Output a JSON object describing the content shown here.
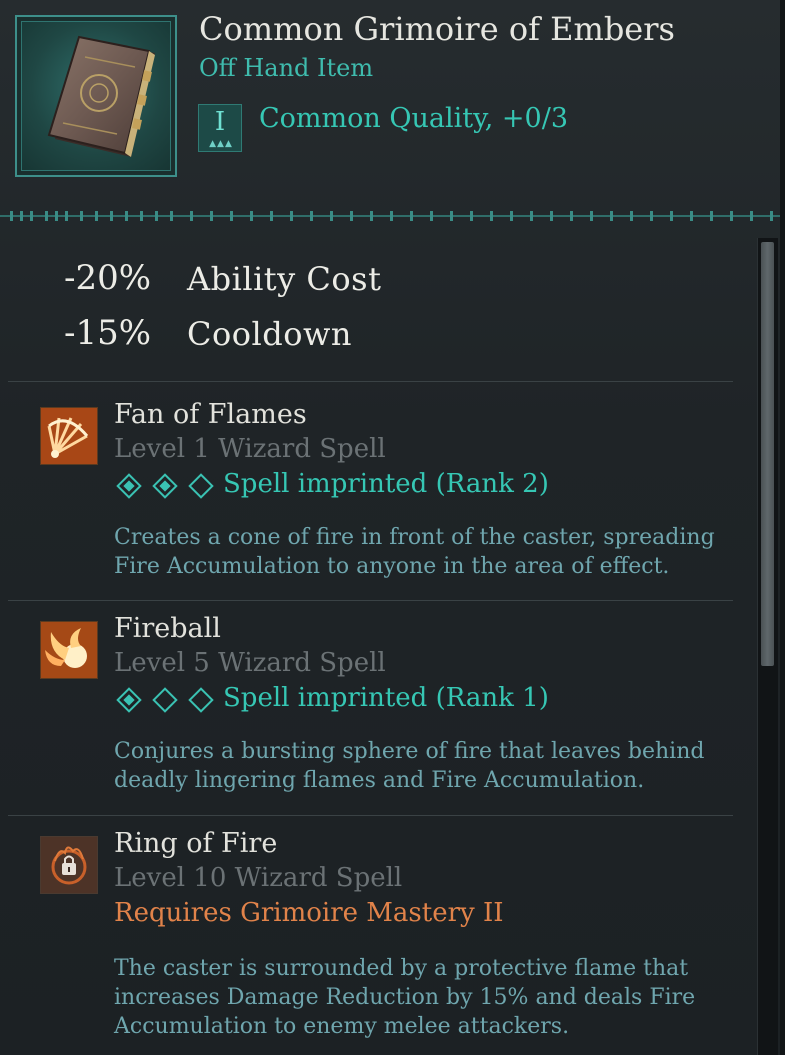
{
  "item": {
    "title": "Common Grimoire of Embers",
    "type": "Off Hand Item",
    "quality_numeral": "I",
    "quality_text": "Common Quality, +0/3",
    "icon": "grimoire-book-icon"
  },
  "stats": [
    {
      "value": "-20%",
      "label": "Ability Cost"
    },
    {
      "value": "-15%",
      "label": "Cooldown"
    }
  ],
  "spells": [
    {
      "name": "Fan of Flames",
      "level": "Level 1 Wizard Spell",
      "rank_filled": 2,
      "rank_total": 3,
      "rank_text": "Spell imprinted (Rank 2)",
      "description_lines": [
        "Creates a cone of fire in front of the caster, spreading",
        "Fire Accumulation to anyone in the area of effect."
      ],
      "icon": "fan-of-flames-icon"
    },
    {
      "name": "Fireball",
      "level": "Level 5 Wizard Spell",
      "rank_filled": 1,
      "rank_total": 3,
      "rank_text": "Spell imprinted (Rank 1)",
      "description_lines": [
        "Conjures a bursting sphere of fire that leaves behind",
        "deadly lingering flames and Fire Accumulation."
      ],
      "icon": "fireball-icon"
    },
    {
      "name": "Ring of Fire",
      "level": "Level 10 Wizard Spell",
      "requires": "Requires Grimoire Mastery II",
      "description_lines": [
        "The caster is surrounded by a protective flame that",
        "increases Damage Reduction by 15% and deals Fire",
        "Accumulation to enemy melee attackers."
      ],
      "icon": "locked-ring-of-fire-icon"
    }
  ],
  "colors": {
    "accent": "#36c7b4",
    "requirement": "#e1834a",
    "description": "#6fa6ae",
    "muted": "#6b7275"
  },
  "scrollbar": {
    "visible_fraction": 0.52
  }
}
